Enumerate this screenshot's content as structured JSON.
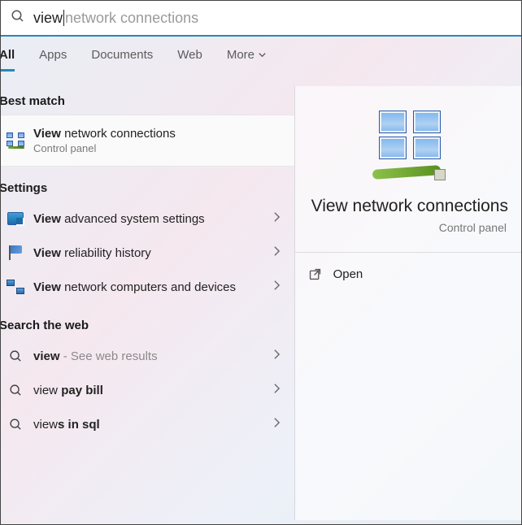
{
  "search": {
    "typed": "view ",
    "suggestion": "network connections"
  },
  "tabs": {
    "all": "All",
    "apps": "Apps",
    "documents": "Documents",
    "web": "Web",
    "more": "More"
  },
  "sections": {
    "best_match": "Best match",
    "settings": "Settings",
    "search_web": "Search the web"
  },
  "best": {
    "prefix_bold": "View",
    "rest": " network connections",
    "sub": "Control panel"
  },
  "settings_items": [
    {
      "prefix_bold": "View",
      "rest": " advanced system settings"
    },
    {
      "prefix_bold": "View",
      "rest": " reliability history"
    },
    {
      "prefix_bold": "View",
      "rest": " network computers and devices"
    }
  ],
  "web_items": [
    {
      "pre": "",
      "bold": "view",
      "post": "",
      "hint": " - See web results"
    },
    {
      "pre": "view ",
      "bold": "pay bill",
      "post": "",
      "hint": ""
    },
    {
      "pre": "view",
      "bold": "s in sql",
      "post": "",
      "hint": ""
    }
  ],
  "preview": {
    "title": "View network connections",
    "sub": "Control panel",
    "open": "Open"
  }
}
